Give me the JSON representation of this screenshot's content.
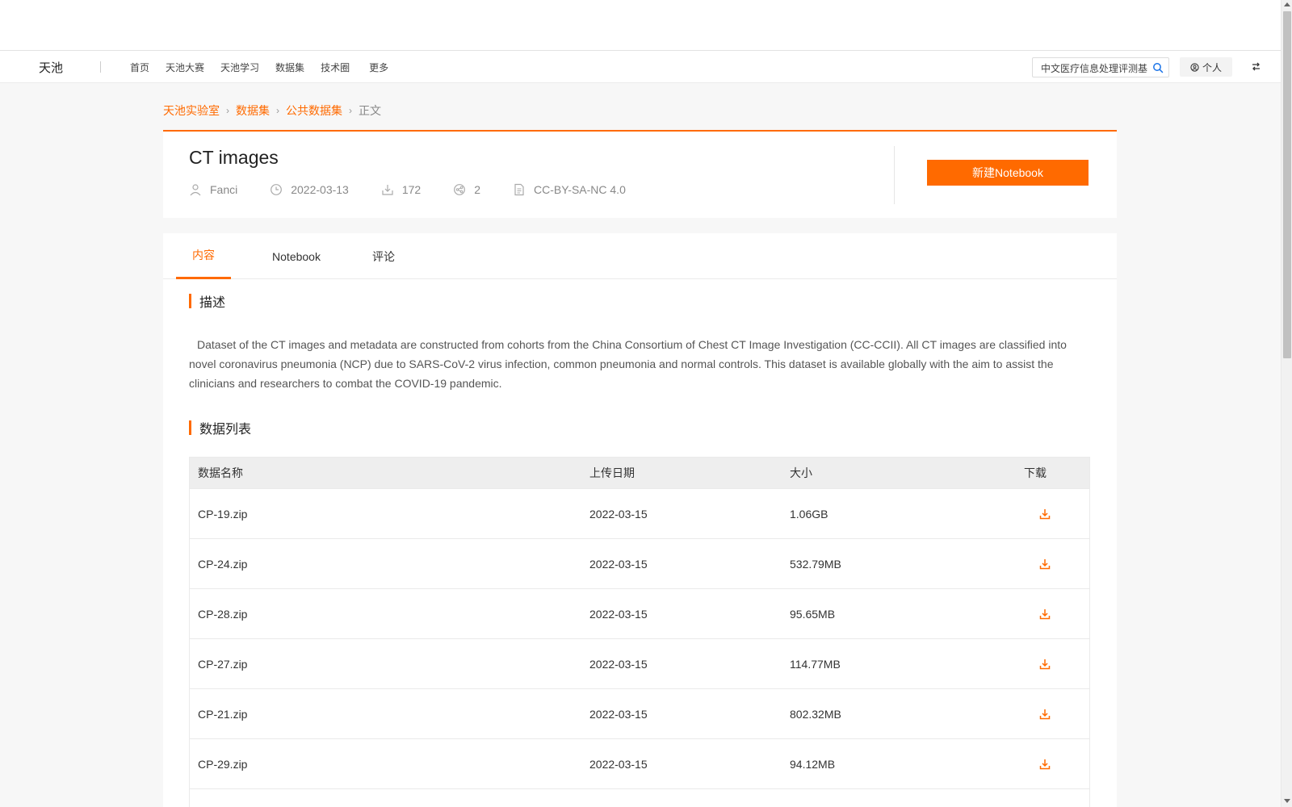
{
  "nav": {
    "brand": "天池",
    "links": [
      "首页",
      "天池大赛",
      "天池学习",
      "数据集",
      "技术圈"
    ],
    "more": "更多",
    "search_value": "中文医疗信息处理评测基",
    "personal": "个人"
  },
  "breadcrumb": [
    "天池实验室",
    "数据集",
    "公共数据集",
    "正文"
  ],
  "dataset": {
    "title": "CT images",
    "author": "Fanci",
    "date": "2022-03-13",
    "downloads": "172",
    "shares": "2",
    "license": "CC-BY-SA-NC 4.0",
    "new_notebook": "新建Notebook"
  },
  "tabs": [
    "内容",
    "Notebook",
    "评论"
  ],
  "description": {
    "heading": "描述",
    "text": "Dataset of the CT images and metadata are constructed from cohorts from the China Consortium of Chest CT Image Investigation (CC-CCII). All CT images are classified into novel coronavirus pneumonia (NCP) due to SARS-CoV-2 virus infection, common pneumonia and normal controls. This dataset is available globally with the aim to assist the clinicians and researchers to combat the COVID-19 pandemic."
  },
  "data_list": {
    "heading": "数据列表",
    "columns": [
      "数据名称",
      "上传日期",
      "大小",
      "下载"
    ],
    "rows": [
      {
        "name": "CP-19.zip",
        "date": "2022-03-15",
        "size": "1.06GB"
      },
      {
        "name": "CP-24.zip",
        "date": "2022-03-15",
        "size": "532.79MB"
      },
      {
        "name": "CP-28.zip",
        "date": "2022-03-15",
        "size": "95.65MB"
      },
      {
        "name": "CP-27.zip",
        "date": "2022-03-15",
        "size": "114.77MB"
      },
      {
        "name": "CP-21.zip",
        "date": "2022-03-15",
        "size": "802.32MB"
      },
      {
        "name": "CP-29.zip",
        "date": "2022-03-15",
        "size": "94.12MB"
      }
    ]
  },
  "colors": {
    "accent": "#ff6a00",
    "page_bg": "#f7f7f7",
    "header_bg": "#eeeeee"
  },
  "icons": {
    "author": "user-icon",
    "date": "clock-icon",
    "downloads": "download-icon",
    "shares": "share-icon",
    "license": "document-icon",
    "search": "search-icon",
    "personal": "user-circle-icon",
    "switch": "switch-icon"
  }
}
